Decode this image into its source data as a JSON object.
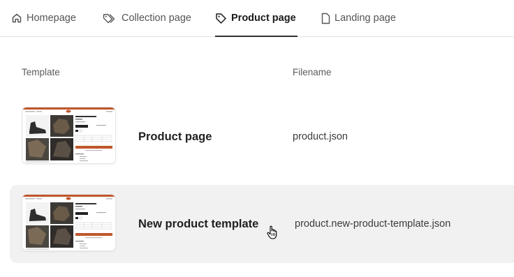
{
  "tabs": [
    {
      "label": "Homepage",
      "icon": "home-icon",
      "active": false
    },
    {
      "label": "Collection page",
      "icon": "tags-icon",
      "active": false
    },
    {
      "label": "Product page",
      "icon": "tag-icon",
      "active": true
    },
    {
      "label": "Landing page",
      "icon": "page-icon",
      "active": false
    }
  ],
  "table": {
    "headers": {
      "template": "Template",
      "filename": "Filename"
    },
    "rows": [
      {
        "name": "Product page",
        "filename": "product.json",
        "hovered": false
      },
      {
        "name": "New product template",
        "filename": "product.new-product-template.json",
        "hovered": true
      }
    ]
  },
  "colors": {
    "accent": "#c0572c",
    "active_tab_underline": "#303030",
    "hover_row_bg": "#f1f1f1"
  }
}
